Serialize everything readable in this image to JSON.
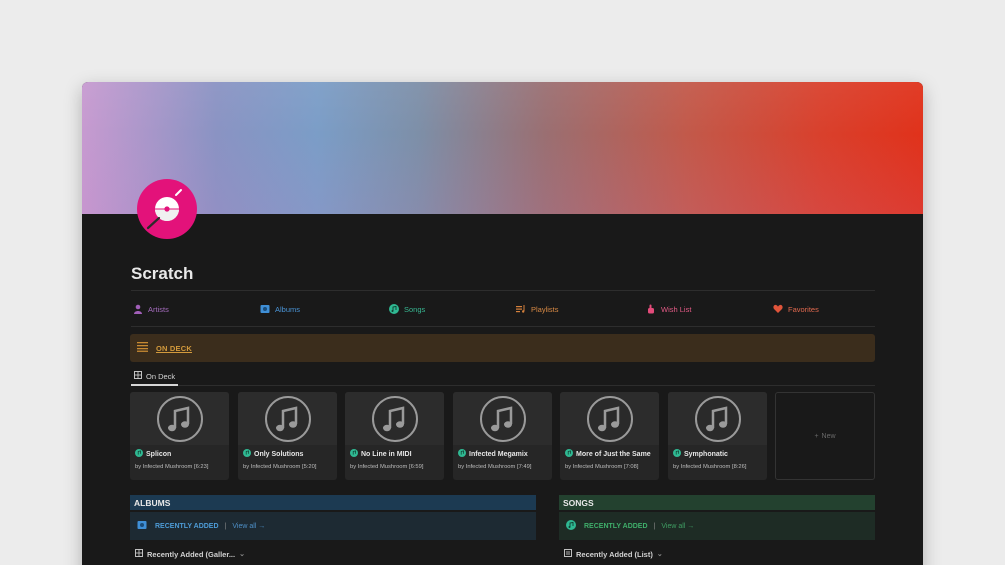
{
  "page": {
    "title": "Scratch"
  },
  "nav": [
    {
      "label": "Artists",
      "icon": "artist-icon",
      "color": "#a15fb8"
    },
    {
      "label": "Albums",
      "icon": "album-icon",
      "color": "#3f8fd6"
    },
    {
      "label": "Songs",
      "icon": "music-note-icon",
      "color": "#2fb892"
    },
    {
      "label": "Playlists",
      "icon": "playlist-icon",
      "color": "#d6813c"
    },
    {
      "label": "Wish List",
      "icon": "hand-icon",
      "color": "#e34b7a"
    },
    {
      "label": "Favorites",
      "icon": "heart-icon",
      "color": "#e0543a"
    }
  ],
  "on_deck": {
    "callout_label": "ON DECK",
    "view_tab": "On Deck",
    "new_label": "New",
    "songs": [
      {
        "title": "Splicon",
        "subtitle": "by Infected Mushroom [6:23]"
      },
      {
        "title": "Only Solutions",
        "subtitle": "by Infected Mushroom [5:20]"
      },
      {
        "title": "No Line in MIDI",
        "subtitle": "by Infected Mushroom [6:59]"
      },
      {
        "title": "Infected Megamix",
        "subtitle": "by Infected Mushroom [7:49]"
      },
      {
        "title": "More of Just the Same",
        "subtitle": "by Infected Mushroom [7:08]"
      },
      {
        "title": "Symphonatic",
        "subtitle": "by Infected Mushroom [8:26]"
      }
    ]
  },
  "albums_section": {
    "header": "ALBUMS",
    "label": "RECENTLY ADDED",
    "pipe": "|",
    "view_all": "View all →",
    "view_name": "Recently Added (Galler...",
    "colors": {
      "header_bg": "#1c3a52",
      "body_bg": "#1d2a33",
      "label": "#4d9bd6"
    }
  },
  "songs_section": {
    "header": "SONGS",
    "label": "RECENTLY ADDED",
    "pipe": "|",
    "view_all": "View all →",
    "view_name": "Recently Added (List)",
    "colors": {
      "header_bg": "#23412f",
      "body_bg": "#1e2c25",
      "label": "#3fae6a"
    }
  }
}
